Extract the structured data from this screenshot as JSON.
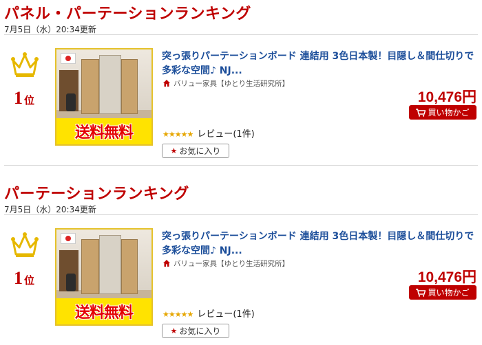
{
  "sections": [
    {
      "title": "パネル・パーテーションランキング",
      "updated": "7月5日（水）20:34更新",
      "item": {
        "rank": "1",
        "rank_unit": "位",
        "title": "突っ張りパーテーションボード 連結用 3色日本製！目隠し＆間仕切りで多彩な空間♪ NJ...",
        "shop": "バリュー家具【ゆとり生活研究所】",
        "price": "10,476円",
        "cart_label": "買い物かご",
        "rating_label": "レビュー(1件)",
        "favorite_label": "お気に入り",
        "badge": "送料無料"
      }
    },
    {
      "title": "パーテーションランキング",
      "updated": "7月5日（水）20:34更新",
      "item": {
        "rank": "1",
        "rank_unit": "位",
        "title": "突っ張りパーテーションボード 連結用 3色日本製！目隠し＆間仕切りで多彩な空間♪ NJ...",
        "shop": "バリュー家具【ゆとり生活研究所】",
        "price": "10,476円",
        "cart_label": "買い物かご",
        "rating_label": "レビュー(1件)",
        "favorite_label": "お気に入り",
        "badge": "送料無料"
      }
    }
  ],
  "icons": {
    "crown": "crown-icon",
    "shop": "home-icon",
    "cart": "cart-icon",
    "favorite": "star-icon",
    "rating": "star-rating-icon"
  },
  "colors": {
    "accent": "#bf0000",
    "title_link": "#1c4e9a",
    "crown": "#e6b800"
  }
}
